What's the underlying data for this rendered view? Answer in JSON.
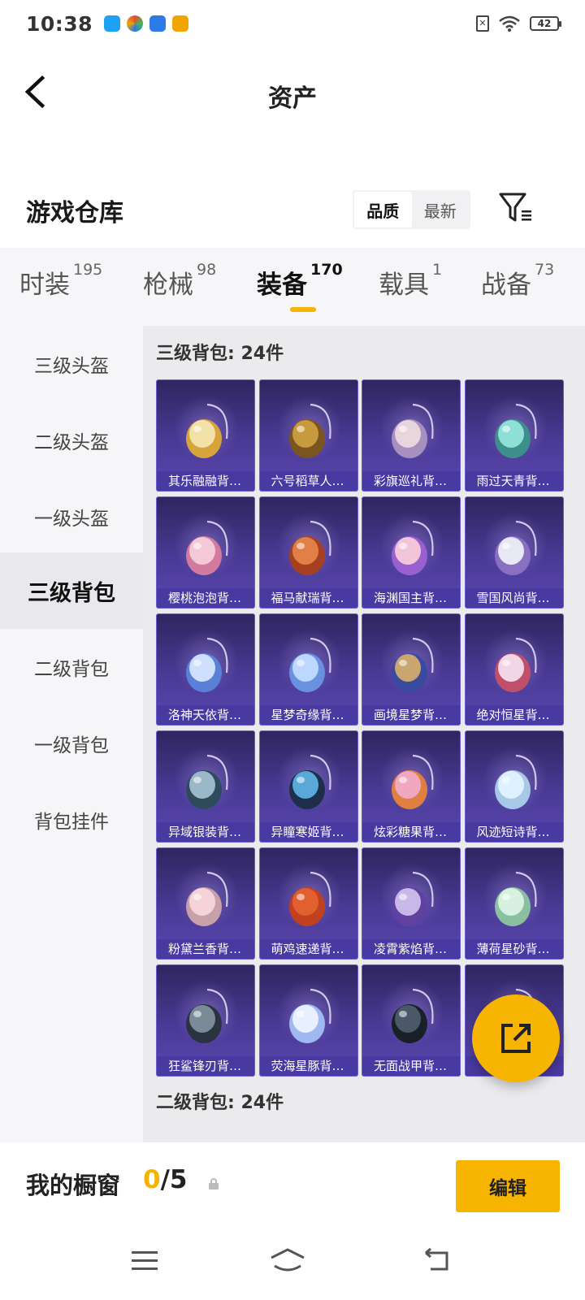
{
  "status_bar": {
    "time": "10:38",
    "battery": "42",
    "notif_colors": [
      "#1ea1f2",
      "#e74c3c",
      "#2d7be5",
      "#f0a500"
    ]
  },
  "header": {
    "title": "资产"
  },
  "warehouse": {
    "title": "游戏仓库",
    "sort_options": [
      "品质",
      "最新"
    ],
    "active_sort": "品质"
  },
  "category_tabs": [
    {
      "label": "时装",
      "count": "195"
    },
    {
      "label": "枪械",
      "count": "98"
    },
    {
      "label": "装备",
      "count": "170"
    },
    {
      "label": "载具",
      "count": "1"
    },
    {
      "label": "战备",
      "count": "73"
    }
  ],
  "sidebar": {
    "items": [
      "三级头盔",
      "二级头盔",
      "一级头盔",
      "三级背包",
      "二级背包",
      "一级背包",
      "背包挂件"
    ],
    "active_index": 3
  },
  "sections": [
    {
      "title": "三级背包: 24件"
    },
    {
      "title": "二级背包: 24件"
    }
  ],
  "items": [
    {
      "name": "其乐融融背…",
      "icon": "backpack-icon"
    },
    {
      "name": "六号稻草人…",
      "icon": "backpack-icon"
    },
    {
      "name": "彩旗巡礼背…",
      "icon": "backpack-icon"
    },
    {
      "name": "雨过天青背…",
      "icon": "backpack-icon"
    },
    {
      "name": "樱桃泡泡背…",
      "icon": "backpack-icon"
    },
    {
      "name": "福马献瑞背…",
      "icon": "backpack-icon"
    },
    {
      "name": "海渊国主背…",
      "icon": "backpack-icon"
    },
    {
      "name": "雪国风尚背…",
      "icon": "backpack-icon"
    },
    {
      "name": "洛神天依背…",
      "icon": "backpack-icon"
    },
    {
      "name": "星梦奇缘背…",
      "icon": "backpack-icon"
    },
    {
      "name": "画境星梦背…",
      "icon": "backpack-icon"
    },
    {
      "name": "绝对恒星背…",
      "icon": "backpack-icon"
    },
    {
      "name": "异域银装背…",
      "icon": "backpack-icon"
    },
    {
      "name": "异瞳寒姬背…",
      "icon": "backpack-icon"
    },
    {
      "name": "炫彩糖果背…",
      "icon": "backpack-icon"
    },
    {
      "name": "风迹短诗背…",
      "icon": "backpack-icon"
    },
    {
      "name": "粉黛兰香背…",
      "icon": "backpack-icon"
    },
    {
      "name": "萌鸡速递背…",
      "icon": "backpack-icon"
    },
    {
      "name": "凌霄紫焰背…",
      "icon": "backpack-icon"
    },
    {
      "name": "薄荷星砂背…",
      "icon": "backpack-icon"
    },
    {
      "name": "狂鲨锋刃背…",
      "icon": "backpack-icon"
    },
    {
      "name": "荧海星豚背…",
      "icon": "backpack-icon"
    },
    {
      "name": "无面战甲背…",
      "icon": "backpack-icon"
    },
    {
      "name": "",
      "icon": "backpack-icon"
    }
  ],
  "showcase": {
    "label": "我的橱窗",
    "current": "0",
    "max": "/5",
    "edit_label": "编辑"
  },
  "colors": {
    "accent": "#f7b400",
    "item_bg": "#4a3a95"
  }
}
